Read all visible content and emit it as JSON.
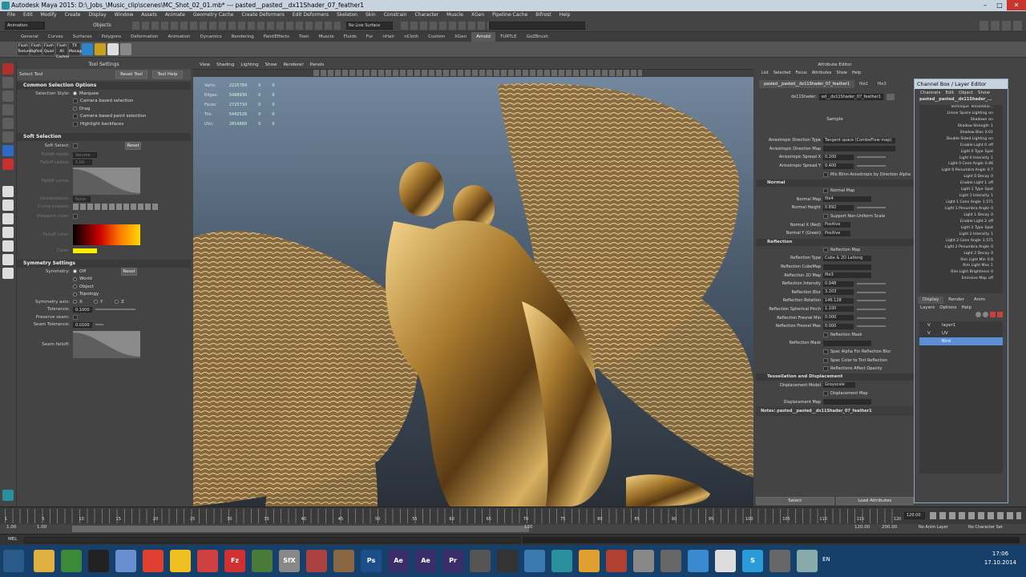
{
  "window": {
    "title": "Autodesk Maya 2015: D:\\_Jobs_\\Music_clip\\scenes\\MC_Shot_02_01.mb* --- pasted__pasted__dx11Shader_07_feather1",
    "buttons": [
      "–",
      "□",
      "✕"
    ]
  },
  "menubar": [
    "File",
    "Edit",
    "Modify",
    "Create",
    "Display",
    "Window",
    "Assets",
    "Animate",
    "Geometry Cache",
    "Create Deformers",
    "Edit Deformers",
    "Skeleton",
    "Skin",
    "Constrain",
    "Character",
    "Muscle",
    "XGen",
    "Pipeline Cache",
    "Bifrost",
    "Help"
  ],
  "statusline": {
    "mode": "Animation",
    "objects_label": "Objects",
    "live_surface": "No Live Surface"
  },
  "shelf_tabs": [
    "General",
    "Curves",
    "Surfaces",
    "Polygons",
    "Deformation",
    "Animation",
    "Dynamics",
    "Rendering",
    "PaintEffects",
    "Toon",
    "Muscle",
    "Fluids",
    "Fur",
    "nHair",
    "nCloth",
    "Custom",
    "XGen",
    "Arnold",
    "TURTLE",
    "GoZBrush"
  ],
  "shelf_active": "Arnold",
  "shelf_icons": [
    {
      "label": "Flush Texture",
      "color": "#3a3a3a"
    },
    {
      "label": "Flush Bgfind",
      "color": "#3a3a3a"
    },
    {
      "label": "Flush Quad",
      "color": "#3a3a3a"
    },
    {
      "label": "Flush All Caches",
      "color": "#3a3a3a"
    },
    {
      "label": "TX Manager",
      "color": "#3a3a3a"
    },
    {
      "label": "",
      "color": "#2d84c8"
    },
    {
      "label": "",
      "color": "#c8a020"
    },
    {
      "label": "",
      "color": "#dddddd"
    },
    {
      "label": "",
      "color": "#888888"
    }
  ],
  "tool_settings": {
    "panel_title": "Tool Settings",
    "tool_name": "Select Tool",
    "reset_tool": "Reset Tool",
    "tool_help": "Tool Help",
    "common": {
      "title": "Common Selection Options",
      "style_label": "Selection Style:",
      "style_marquee": "Marquee",
      "camera_based": "Camera based selection",
      "drag": "Drag",
      "camera_paint": "Camera based paint selection",
      "highlight": "Highlight backfaces"
    },
    "soft": {
      "title": "Soft Selection",
      "soft_select": "Soft Select:",
      "reset": "Reset",
      "falloff_mode": "Falloff mode:",
      "falloff_mode_val": "Volume",
      "falloff_radius": "Falloff radius:",
      "falloff_radius_val": "5.00",
      "falloff_curve": "Falloff curve:",
      "interpolation": "Interpolation:",
      "interpolation_val": "None",
      "curve_presets": "Curve presets:",
      "viewport_color": "Viewport color:",
      "falloff_color": "Falloff color:",
      "color": "Color:"
    },
    "symmetry": {
      "title": "Symmetry Settings",
      "symmetry": "Symmetry:",
      "opt_off": "Off",
      "opt_world": "World",
      "opt_object": "Object",
      "opt_topology": "Topology",
      "reset": "Reset",
      "axis": "Symmetry axis:",
      "axis_x": "X",
      "axis_y": "Y",
      "axis_z": "Z",
      "tolerance": "Tolerance:",
      "tolerance_val": "0.1000",
      "preserve": "Preserve seam:",
      "seam_tol": "Seam Tolerance:",
      "seam_tol_val": "0.0100",
      "seam_falloff": "Seam falloff:"
    }
  },
  "viewport": {
    "menu": [
      "View",
      "Shading",
      "Lighting",
      "Show",
      "Renderer",
      "Panels"
    ],
    "hud": [
      {
        "label": "Verts:",
        "v1": "2225784",
        "v2": "0",
        "v3": "0"
      },
      {
        "label": "Edges:",
        "v1": "5468930",
        "v2": "0",
        "v3": "0"
      },
      {
        "label": "Faces:",
        "v1": "2725710",
        "v2": "0",
        "v3": "0"
      },
      {
        "label": "Tris:",
        "v1": "5442526",
        "v2": "0",
        "v3": "0"
      },
      {
        "label": "UVs:",
        "v1": "2814660",
        "v2": "0",
        "v3": "0"
      }
    ]
  },
  "attribute_editor": {
    "title": "Attribute Editor",
    "menu": [
      "List",
      "Selected",
      "Focus",
      "Attributes",
      "Show",
      "Help"
    ],
    "tabs": [
      "pasted__pasted__dx11Shader_07_feather1",
      "file2",
      "file3"
    ],
    "shader_label": "dx11Shader:",
    "shader_value": "ed__dx11Shader_07_feather1",
    "focus_btn": "Focus",
    "presets_btn": "Presets",
    "show_btn": "Show",
    "sample": "Sample",
    "anisotropic": {
      "direction_type_label": "Anisotropic Direction Type",
      "direction_type": "Tangent space (ComboFlow map)",
      "direction_map": "Anisotropic Direction Map",
      "spread_x_label": "Anisotropic Spread X",
      "spread_x": "0.200",
      "spread_y_label": "Anisotropic Spread Y",
      "spread_y": "0.400",
      "mix": "Mix Blinn-Anisotropic by Direction Alpha"
    },
    "normal": {
      "title": "Normal",
      "normal_map_chk": "Normal Map",
      "normal_map_label": "Normal Map",
      "normal_map": "file4",
      "normal_height_label": "Normal Height",
      "normal_height": "0.892",
      "mixed_scale": "Support Non-Uniform Scale",
      "x_label": "Normal X (Red)",
      "x_val": "Positive",
      "y_label": "Normal Y (Green)",
      "y_val": "Positive"
    },
    "reflection": {
      "title": "Reflection",
      "reflection_map": "Reflection Map",
      "type_label": "Reflection Type",
      "type_val": "Cube & 2D Latlong",
      "cubemap_label": "Reflection CubeMap",
      "map2d_label": "Reflection 2D Map",
      "map2d": "file3",
      "intensity_label": "Reflection Intensity",
      "intensity": "0.948",
      "blur_label": "Reflection Blur",
      "blur": "3.203",
      "rotation_label": "Reflection Rotation",
      "rotation": "146.128",
      "spherical_label": "Reflection Spherical Pinch",
      "spherical": "1.100",
      "fresnel_min_label": "Reflection Fresnel Min",
      "fresnel_min": "0.000",
      "fresnel_max_label": "Reflection Fresnel Max",
      "fresnel_max": "0.000",
      "mask_chk": "Reflection Mask",
      "mask_label": "Reflection Mask",
      "spec_alpha": "Spec Alpha For Reflection Blur",
      "spec_color": "Spec Color to Tint Reflection",
      "opacity": "Reflections Affect Opacity"
    },
    "tessellation": {
      "title": "Tessellation and Displacement",
      "model_label": "Displacement Model",
      "model_val": "Grayscale",
      "map_chk": "Displacement Map",
      "map_label": "Displacement Map"
    },
    "notes": "Notes:  pasted__pasted__dx11Shader_07_feather1",
    "select_btn": "Select",
    "load_btn": "Load Attributes",
    "copy_btn": "Copy Tab"
  },
  "channel_box": {
    "title": "Channel Box / Layer Editor",
    "menu": [
      "Channels",
      "Edit",
      "Object",
      "Show"
    ],
    "object": "pasted__pasted__dx11Shader_...",
    "attrs": [
      {
        "n": "Technique",
        "v": "Tessellatio..."
      },
      {
        "n": "Linear Space Lighting",
        "v": "on"
      },
      {
        "n": "Shadows",
        "v": "on"
      },
      {
        "n": "Shadow Strength",
        "v": "1"
      },
      {
        "n": "Shadow Bias",
        "v": "0.01"
      },
      {
        "n": "Double Sided Lighting",
        "v": "on"
      },
      {
        "n": "Enable Light 0",
        "v": "off"
      },
      {
        "n": "Light 0 Type",
        "v": "Spot"
      },
      {
        "n": "Light 0 Intensity",
        "v": "1"
      },
      {
        "n": "Light 0 Cone Angle",
        "v": "0.46"
      },
      {
        "n": "Light 0 Penumbra Angle",
        "v": "0.7"
      },
      {
        "n": "Light 0 Decay",
        "v": "0"
      },
      {
        "n": "Enable Light 1",
        "v": "off"
      },
      {
        "n": "Light 1 Type",
        "v": "Spot"
      },
      {
        "n": "Light 1 Intensity",
        "v": "1"
      },
      {
        "n": "Light 1 Cone Angle",
        "v": "1.571"
      },
      {
        "n": "Light 1 Penumbra Angle",
        "v": "0"
      },
      {
        "n": "Light 1 Decay",
        "v": "0"
      },
      {
        "n": "Enable Light 2",
        "v": "off"
      },
      {
        "n": "Light 2 Type",
        "v": "Spot"
      },
      {
        "n": "Light 2 Intensity",
        "v": "1"
      },
      {
        "n": "Light 2 Cone Angle",
        "v": "1.571"
      },
      {
        "n": "Light 2 Penumbra Angle",
        "v": "0"
      },
      {
        "n": "Light 2 Decay",
        "v": "0"
      },
      {
        "n": "Rim Light Min",
        "v": "0.8"
      },
      {
        "n": "Rim Light Max",
        "v": "1"
      },
      {
        "n": "Rim Light Brightness",
        "v": "0"
      },
      {
        "n": "Emissive Map",
        "v": "off"
      }
    ],
    "layer_tabs": [
      "Display",
      "Render",
      "Anim"
    ],
    "layer_menu": [
      "Layers",
      "Options",
      "Help"
    ],
    "layers": [
      {
        "v": "V",
        "name": "layer1",
        "sel": false
      },
      {
        "v": "V",
        "name": "UV",
        "sel": false
      },
      {
        "v": "",
        "name": "Bird",
        "sel": true
      }
    ]
  },
  "timeline": {
    "ticks": [
      "1",
      "5",
      "10",
      "15",
      "20",
      "25",
      "30",
      "35",
      "40",
      "45",
      "50",
      "55",
      "60",
      "65",
      "70",
      "75",
      "80",
      "85",
      "90",
      "95",
      "100",
      "105",
      "110",
      "115",
      "120"
    ],
    "current": "120.00",
    "start": "1.00",
    "start2": "1.00",
    "range_end_mid": "120",
    "end1": "120.00",
    "end2": "200.00",
    "anim_layer": "No Anim Layer",
    "char_set": "No Character Set"
  },
  "cmdline": {
    "label": "MEL"
  },
  "taskbar": {
    "lang": "EN",
    "time": "17:06",
    "date": "17.10.2014",
    "apps": [
      {
        "l": "",
        "c": "#e0b040"
      },
      {
        "l": "",
        "c": "#3a8a3a"
      },
      {
        "l": "",
        "c": "#222"
      },
      {
        "l": "",
        "c": "#6a8fd0"
      },
      {
        "l": "",
        "c": "#e04030"
      },
      {
        "l": "",
        "c": "#f0c020"
      },
      {
        "l": "",
        "c": "#d04040"
      },
      {
        "l": "Fz",
        "c": "#d03030"
      },
      {
        "l": "",
        "c": "#4a7a3a"
      },
      {
        "l": "SfX",
        "c": "#888"
      },
      {
        "l": "",
        "c": "#aa4040"
      },
      {
        "l": "",
        "c": "#886644"
      },
      {
        "l": "Ps",
        "c": "#1c4f8a"
      },
      {
        "l": "Ae",
        "c": "#3a2e6a"
      },
      {
        "l": "Ae",
        "c": "#3a2e6a"
      },
      {
        "l": "Pr",
        "c": "#3a2e6a"
      },
      {
        "l": "",
        "c": "#555"
      },
      {
        "l": "",
        "c": "#333"
      },
      {
        "l": "",
        "c": "#3a7ab0"
      },
      {
        "l": "",
        "c": "#2a8f9c"
      },
      {
        "l": "",
        "c": "#e0a030"
      },
      {
        "l": "",
        "c": "#b04030"
      },
      {
        "l": "",
        "c": "#888"
      },
      {
        "l": "",
        "c": "#666"
      },
      {
        "l": "",
        "c": "#3a8ad0"
      },
      {
        "l": "",
        "c": "#dddddd"
      },
      {
        "l": "S",
        "c": "#2a9ad8"
      },
      {
        "l": "",
        "c": "#666"
      },
      {
        "l": "",
        "c": "#8aa"
      }
    ]
  }
}
